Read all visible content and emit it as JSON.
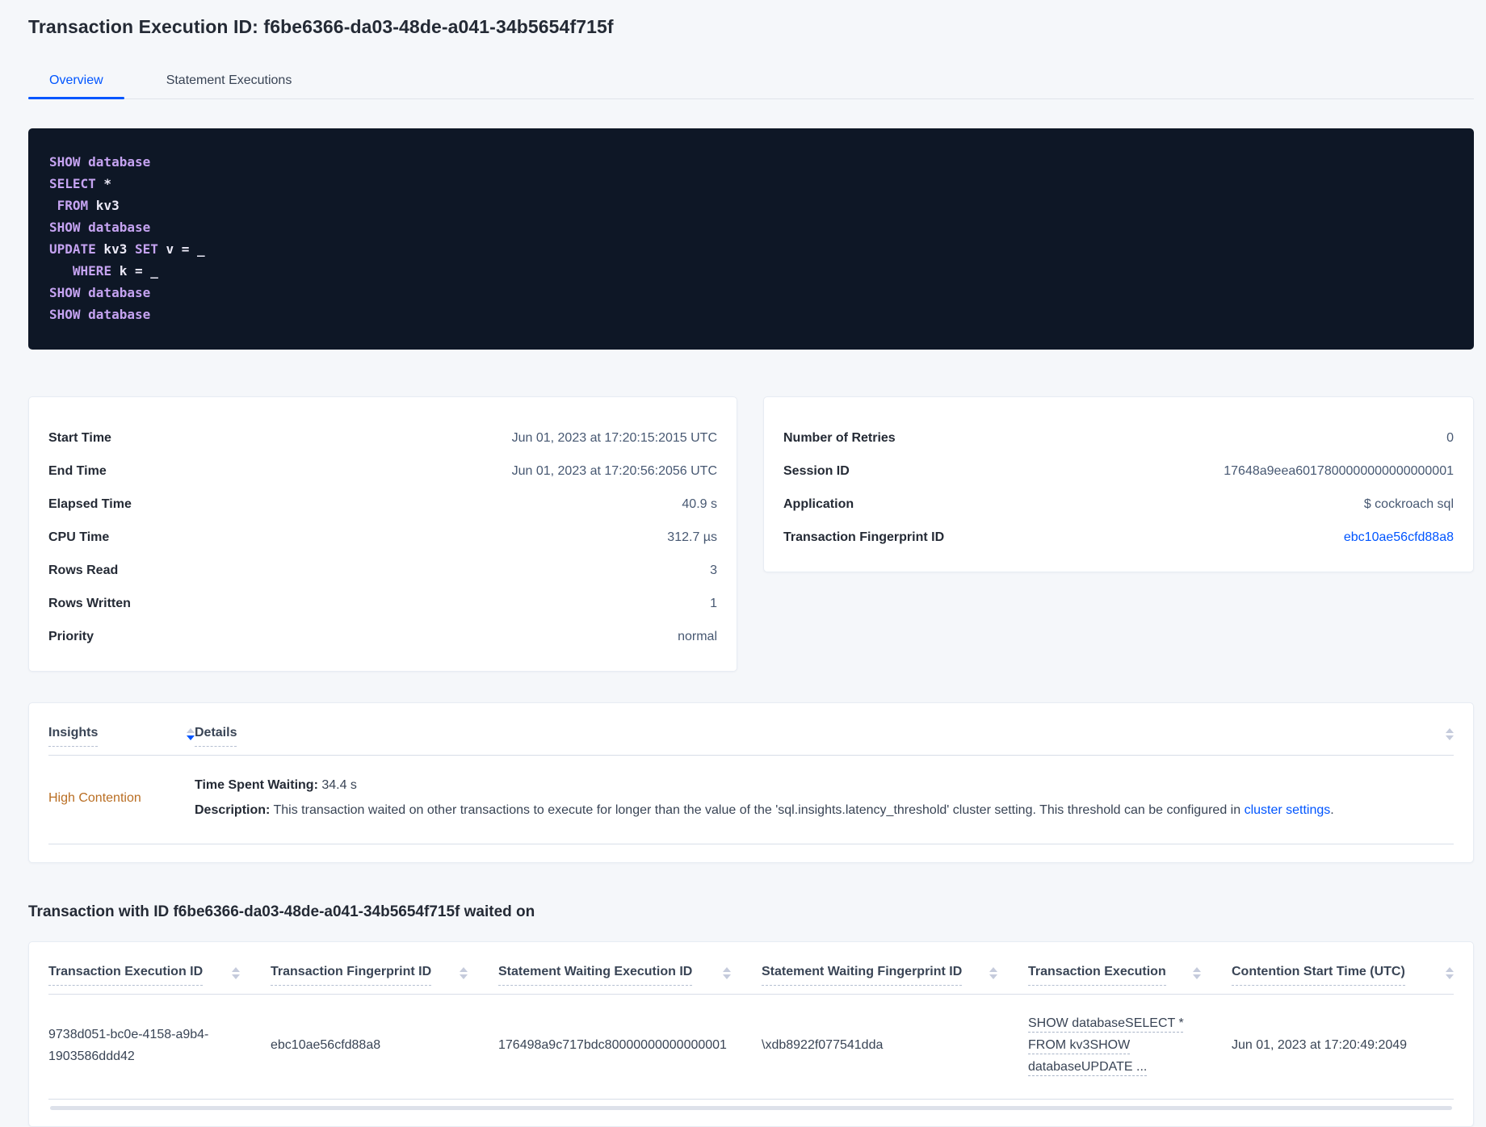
{
  "header": {
    "title": "Transaction Execution ID: f6be6366-da03-48de-a041-34b5654f715f"
  },
  "tabs": {
    "overview": "Overview",
    "statement_executions": "Statement Executions"
  },
  "sql": {
    "lines": [
      [
        [
          "kw",
          "SHOW database"
        ]
      ],
      [
        [
          "kw",
          "SELECT"
        ],
        [
          "pl",
          " *"
        ]
      ],
      [
        [
          "pl",
          " "
        ],
        [
          "kw",
          "FROM"
        ],
        [
          "pl",
          " kv3"
        ]
      ],
      [
        [
          "kw",
          "SHOW database"
        ]
      ],
      [
        [
          "kw",
          "UPDATE"
        ],
        [
          "pl",
          " kv3 "
        ],
        [
          "kw",
          "SET"
        ],
        [
          "pl",
          " v = _"
        ]
      ],
      [
        [
          "pl",
          "   "
        ],
        [
          "kw",
          "WHERE"
        ],
        [
          "pl",
          " k = _"
        ]
      ],
      [
        [
          "kw",
          "SHOW database"
        ]
      ],
      [
        [
          "kw",
          "SHOW database"
        ]
      ]
    ]
  },
  "summary_left": {
    "rows": [
      {
        "label": "Start Time",
        "value": "Jun 01, 2023 at 17:20:15:2015 UTC"
      },
      {
        "label": "End Time",
        "value": "Jun 01, 2023 at 17:20:56:2056 UTC"
      },
      {
        "label": "Elapsed Time",
        "value": "40.9 s"
      },
      {
        "label": "CPU Time",
        "value": "312.7 µs"
      },
      {
        "label": "Rows Read",
        "value": "3"
      },
      {
        "label": "Rows Written",
        "value": "1"
      },
      {
        "label": "Priority",
        "value": "normal"
      }
    ]
  },
  "summary_right": {
    "rows": [
      {
        "label": "Number of Retries",
        "value": "0"
      },
      {
        "label": "Session ID",
        "value": "17648a9eea6017800000000000000001"
      },
      {
        "label": "Application",
        "value": "$ cockroach sql"
      },
      {
        "label": "Transaction Fingerprint ID",
        "value": "ebc10ae56cfd88a8"
      }
    ]
  },
  "insights": {
    "columns": {
      "insights": "Insights",
      "details": "Details"
    },
    "row": {
      "insight": "High Contention",
      "waiting_label": "Time Spent Waiting:",
      "waiting_value": " 34.4 s",
      "description_label": "Description:",
      "description_text": " This transaction waited on other transactions to execute for longer than the value of the 'sql.insights.latency_threshold' cluster setting. This threshold can be configured in ",
      "link_text": "cluster settings",
      "after_link": "."
    }
  },
  "waited_on": {
    "heading": "Transaction with ID f6be6366-da03-48de-a041-34b5654f715f waited on",
    "columns": [
      "Transaction Execution ID",
      "Transaction Fingerprint ID",
      "Statement Waiting Execution ID",
      "Statement Waiting Fingerprint ID",
      "Transaction Execution",
      "Contention Start Time (UTC)"
    ],
    "row": {
      "transaction_execution_id": "9738d051-bc0e-4158-a9b4-1903586ddd42",
      "transaction_fingerprint_id": "ebc10ae56cfd88a8",
      "statement_waiting_execution_id": "176498a9c717bdc80000000000000001",
      "statement_waiting_fingerprint_id": "\\xdb8922f077541dda",
      "transaction_execution": "SHOW databaseSELECT * FROM kv3SHOW databaseUPDATE ...",
      "contention_start_time": "Jun 01, 2023 at 17:20:49:2049"
    }
  },
  "colors": {
    "accent": "#0055ff",
    "warning": "#b96e23",
    "code_bg": "#0e1726"
  }
}
